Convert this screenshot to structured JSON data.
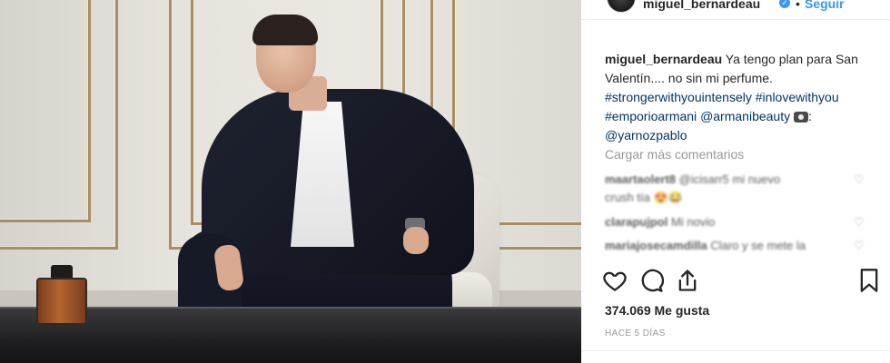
{
  "post": {
    "username": "miguel_bernardeau",
    "dot": "•",
    "follow_label": "Seguir",
    "verified_glyph": "✓"
  },
  "caption": {
    "username": "miguel_bernardeau",
    "text": "Ya tengo plan para San Valentín.... no sin mi perfume.",
    "tags": [
      "#strongerwithyouintensely",
      "#inlovewithyou",
      "#emporioarmani",
      "@armanibeauty"
    ],
    "photo_credit_suffix": ":",
    "photo_credit": "@yarnozpablo"
  },
  "load_more_label": "Cargar más comentarios",
  "comments": [
    {
      "user": "maartaolert8",
      "text": "@icisarr5 mi nuevo"
    },
    {
      "user": "",
      "text": "crush tía 😍😂"
    },
    {
      "user": "clarapujpol",
      "text": "Mi novio"
    },
    {
      "user": "mariajosecamdilla",
      "text": "Claro y se mete la"
    }
  ],
  "likes": {
    "count": "374.069",
    "label": "Me gusta"
  },
  "timestamp": "HACE 5 DÍAS",
  "icons": [
    "heart-icon",
    "comment-icon",
    "share-icon",
    "bookmark-icon",
    "camera-icon"
  ],
  "colors": {
    "link": "#003569",
    "follow": "#3897f0",
    "muted": "#999999"
  }
}
